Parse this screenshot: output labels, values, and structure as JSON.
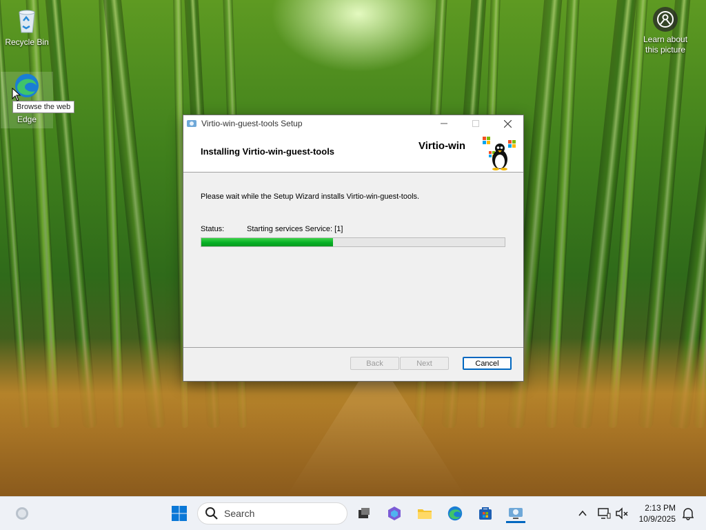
{
  "desktop": {
    "recycle_bin_label": "Recycle Bin",
    "edge_label": "Microsoft\nEdge",
    "edge_label_visible": "Edge",
    "tooltip": "Browse the web",
    "learn_label_line1": "Learn about",
    "learn_label_line2": "this picture"
  },
  "dialog": {
    "title": "Virtio-win-guest-tools Setup",
    "heading": "Installing Virtio-win-guest-tools",
    "brand": "Virtio-win",
    "description": "Please wait while the Setup Wizard installs Virtio-win-guest-tools.",
    "status_label": "Status:",
    "status_value": "Starting services Service: [1]",
    "progress_fraction": 0.435,
    "buttons": {
      "back": "Back",
      "next": "Next",
      "cancel": "Cancel"
    }
  },
  "taskbar": {
    "search_placeholder": "Search",
    "time": "2:13 PM",
    "date": "10/9/2025"
  },
  "colors": {
    "accent": "#0067c0",
    "progress": "#06b025"
  }
}
